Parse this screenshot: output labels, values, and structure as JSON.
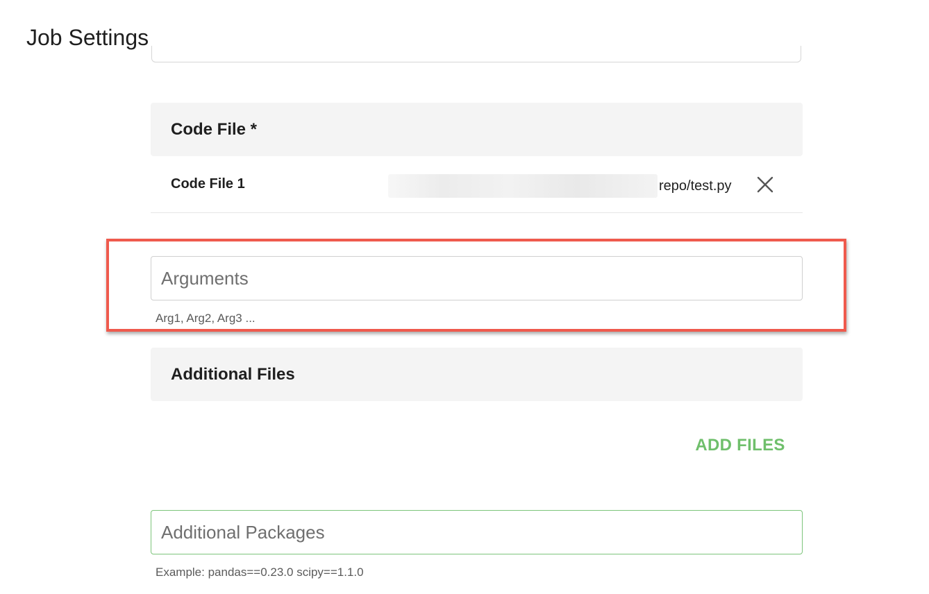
{
  "page": {
    "title": "Job Settings"
  },
  "code_file_section": {
    "header": "Code File *",
    "files": [
      {
        "label": "Code File 1",
        "path_visible": "repo/test.py",
        "remove_icon": "close-icon"
      }
    ]
  },
  "arguments": {
    "placeholder": "Arguments",
    "value": "",
    "helper": "Arg1, Arg2, Arg3 ..."
  },
  "additional_files_section": {
    "header": "Additional Files",
    "add_label": "ADD FILES"
  },
  "additional_packages": {
    "placeholder": "Additional Packages",
    "value": "",
    "helper": "Example: pandas==0.23.0 scipy==1.1.0"
  },
  "colors": {
    "accent_green": "#6fbf6b",
    "highlight_red": "#ef5a4d",
    "section_bg": "#f4f4f4"
  }
}
